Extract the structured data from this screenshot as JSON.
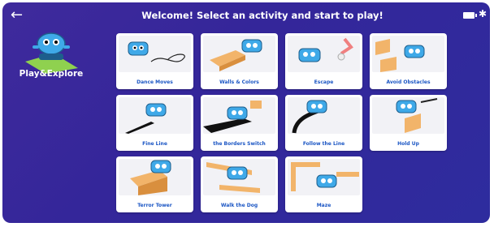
{
  "header": {
    "title": "Welcome! Select an activity and start to play!",
    "back_icon": "arrow-left-icon",
    "battery_icon": "battery-icon",
    "bluetooth_icon": "bluetooth-icon"
  },
  "sidebar": {
    "label": "Play&Explore"
  },
  "activities": [
    {
      "label": "Dance Moves",
      "icon": "robot-dance-icon"
    },
    {
      "label": "Walls & Colors",
      "icon": "robot-wall-icon"
    },
    {
      "label": "Escape",
      "icon": "robot-escape-icon"
    },
    {
      "label": "Avoid Obstacles",
      "icon": "robot-obstacles-icon"
    },
    {
      "label": "Fine Line",
      "icon": "robot-line-icon"
    },
    {
      "label": "the Borders Switch",
      "icon": "robot-borders-icon"
    },
    {
      "label": "Follow the Line",
      "icon": "robot-follow-icon"
    },
    {
      "label": "Hold Up",
      "icon": "robot-holdup-icon"
    },
    {
      "label": "Terror Tower",
      "icon": "robot-tower-icon"
    },
    {
      "label": "Walk the Dog",
      "icon": "robot-walk-icon"
    },
    {
      "label": "Maze",
      "icon": "robot-maze-icon"
    }
  ],
  "colors": {
    "background": "#35289b",
    "card_label": "#1b56c4",
    "robot": "#3fa9e8",
    "block": "#f2b46a"
  }
}
